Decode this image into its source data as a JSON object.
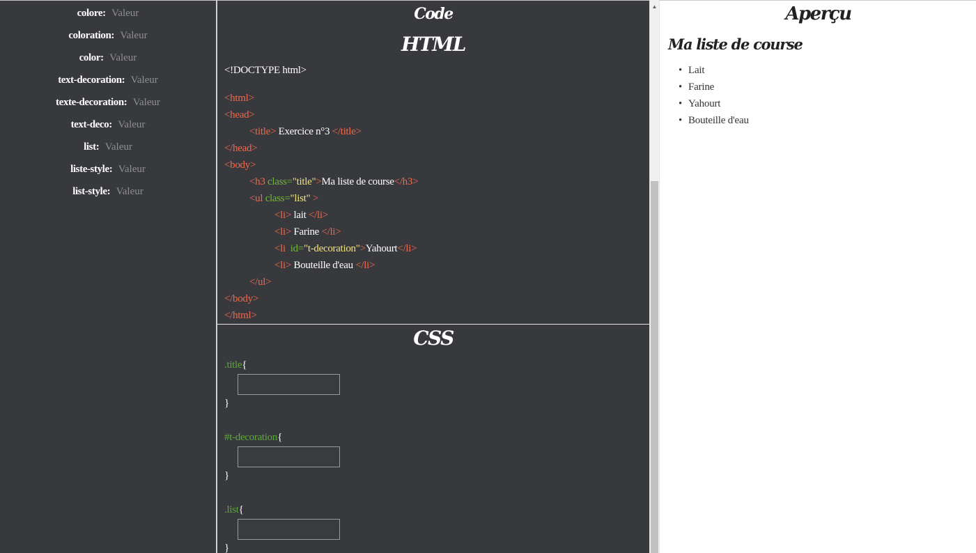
{
  "properties_panel": {
    "value_placeholder": "Valeur",
    "items": [
      {
        "name": "colore"
      },
      {
        "name": "coloration"
      },
      {
        "name": "color"
      },
      {
        "name": "text-decoration"
      },
      {
        "name": "texte-decoration"
      },
      {
        "name": "text-deco"
      },
      {
        "name": "list"
      },
      {
        "name": "liste-style"
      },
      {
        "name": "list-style"
      }
    ]
  },
  "code_panel": {
    "title": "Code",
    "html_title": "HTML",
    "css_title": "CSS",
    "html": {
      "doctype": "<!DOCTYPE html>",
      "html_open": "<html>",
      "head_open": "<head>",
      "title_open": "<title>",
      "title_text": " Exercice n°3 ",
      "title_close": "</title>",
      "head_close": "</head>",
      "body_open": "<body>",
      "h3_open": "<h3 ",
      "h3_attr": "class=",
      "h3_value": "\"title\"",
      "h3_gt": ">",
      "h3_text": "Ma liste de course",
      "h3_close": "</h3>",
      "ul_open": "<ul ",
      "ul_attr": "class=",
      "ul_value": "\"list\"",
      "ul_gt": " >",
      "li_open": "<li>",
      "li_close": "</li>",
      "li1_text": " lait ",
      "li2_text": " Farine ",
      "li3_open": "<li ",
      "li3_attr": " id=",
      "li3_value": "\"t-decoration\"",
      "li3_gt": ">",
      "li3_text": "Yahourt",
      "li4_text": " Bouteille d'eau ",
      "ul_close": "</ul>",
      "body_close": "</body>",
      "html_close": "</html>"
    },
    "css": {
      "rules": [
        {
          "selector": ".title"
        },
        {
          "selector": "#t-decoration"
        },
        {
          "selector": ".list"
        }
      ],
      "open_brace": "{",
      "close_brace": "}"
    }
  },
  "preview": {
    "title": "Aperçu",
    "heading": "Ma liste de course",
    "items": [
      "Lait",
      "Farine",
      "Yahourt",
      "Bouteille d'eau"
    ]
  },
  "colors": {
    "panel_bg": "#38393d",
    "tag": "#f0684d",
    "attribute": "#6fb83a",
    "string": "#f1e27e",
    "selector": "#59a93a"
  }
}
